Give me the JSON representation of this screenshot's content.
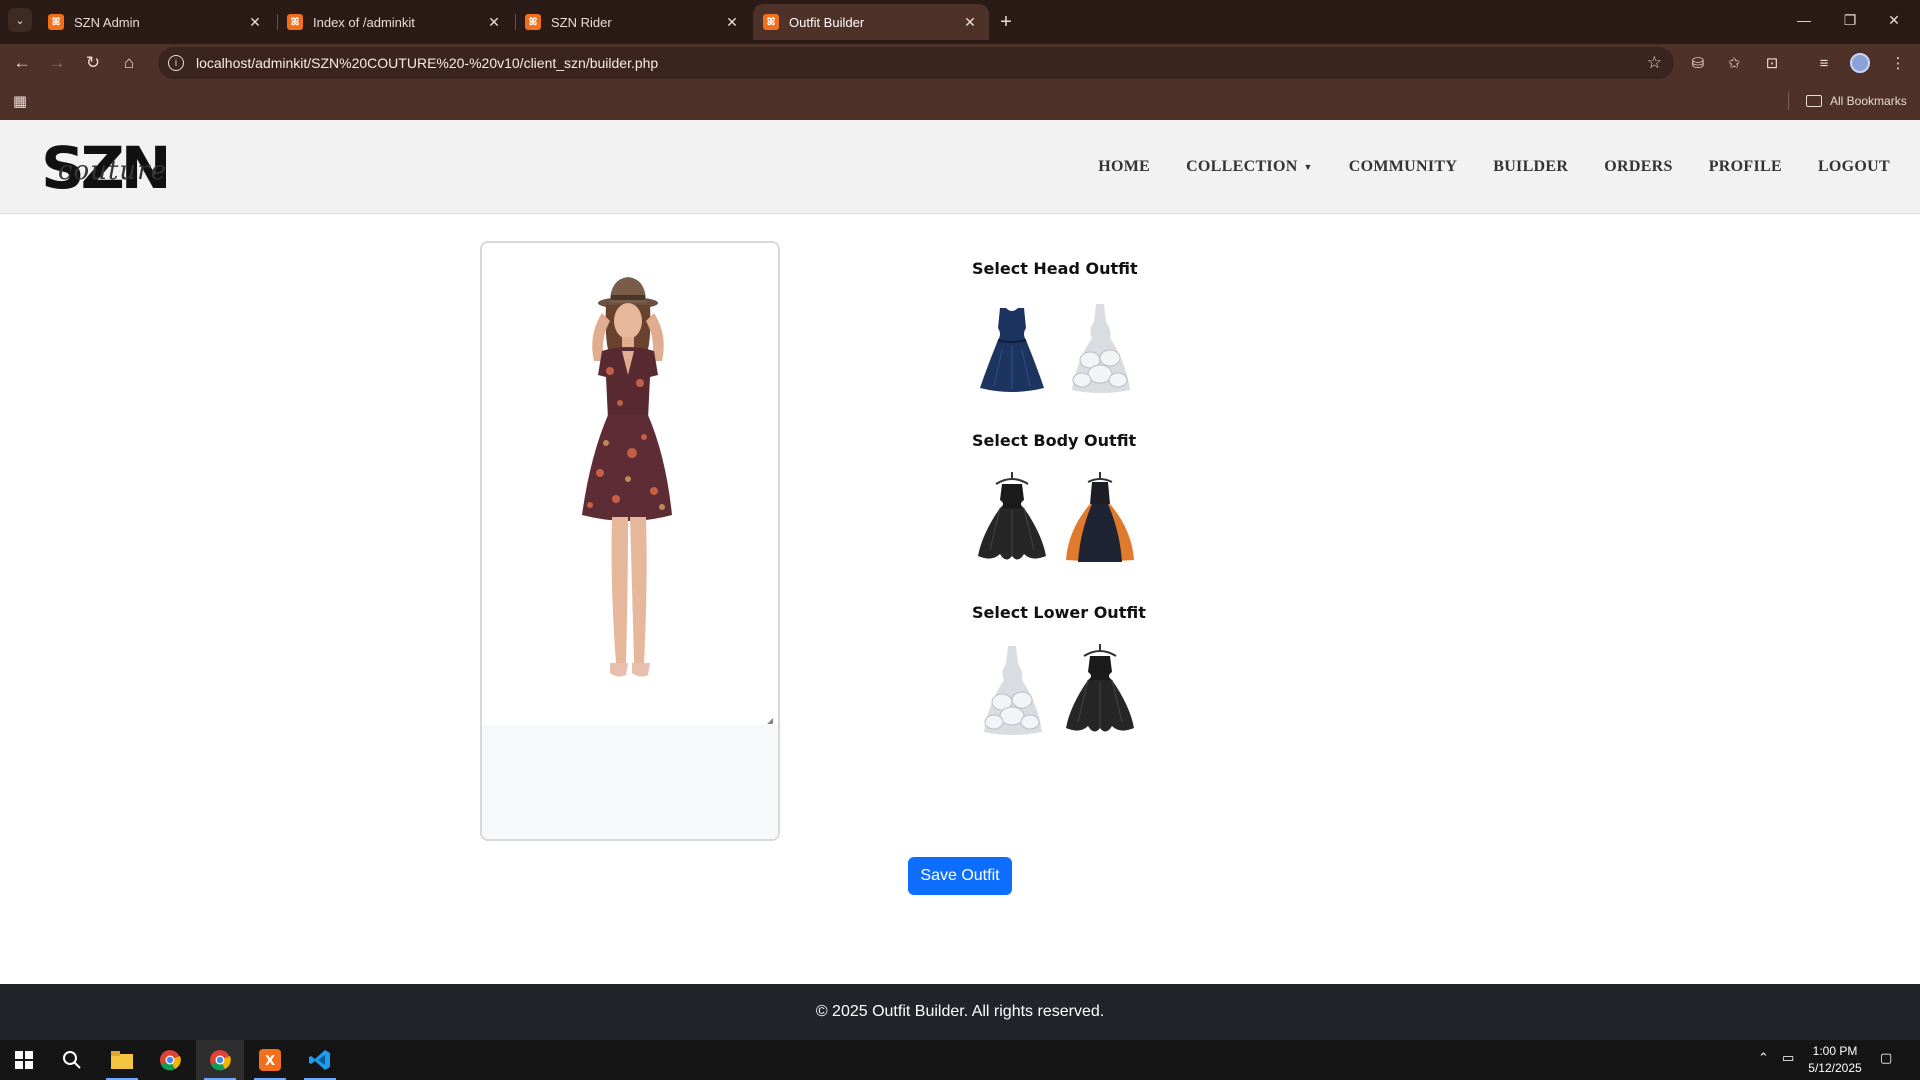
{
  "browser": {
    "tabs": [
      {
        "title": "SZN Admin",
        "active": false
      },
      {
        "title": "Index of /adminkit",
        "active": false
      },
      {
        "title": "SZN Rider",
        "active": false
      },
      {
        "title": "Outfit Builder",
        "active": true
      }
    ],
    "url": "localhost/adminkit/SZN%20COUTURE%20-%20v10/client_szn/builder.php",
    "bookmarks_label": "All Bookmarks"
  },
  "site": {
    "logo_main": "SZN",
    "logo_script": "couture",
    "nav": [
      {
        "label": "HOME"
      },
      {
        "label": "COLLECTION",
        "dropdown": true
      },
      {
        "label": "COMMUNITY"
      },
      {
        "label": "BUILDER"
      },
      {
        "label": "ORDERS"
      },
      {
        "label": "PROFILE"
      },
      {
        "label": "LOGOUT"
      }
    ]
  },
  "builder": {
    "sections": [
      {
        "title": "Select Head Outfit",
        "options": [
          "navy-dress",
          "white-ruffle-gown"
        ]
      },
      {
        "title": "Select Body Outfit",
        "options": [
          "black-tulle-dress",
          "orange-black-gown"
        ]
      },
      {
        "title": "Select Lower Outfit",
        "options": [
          "white-ruffle-gown",
          "black-tulle-dress"
        ]
      }
    ],
    "save_label": "Save Outfit"
  },
  "footer": {
    "text": "© 2025 Outfit Builder. All rights reserved."
  },
  "taskbar": {
    "time": "1:00 PM",
    "date": "5/12/2025"
  },
  "colors": {
    "primary_button": "#0d6efd",
    "footer_bg": "#212529",
    "browser_frame": "#2b1b16"
  }
}
